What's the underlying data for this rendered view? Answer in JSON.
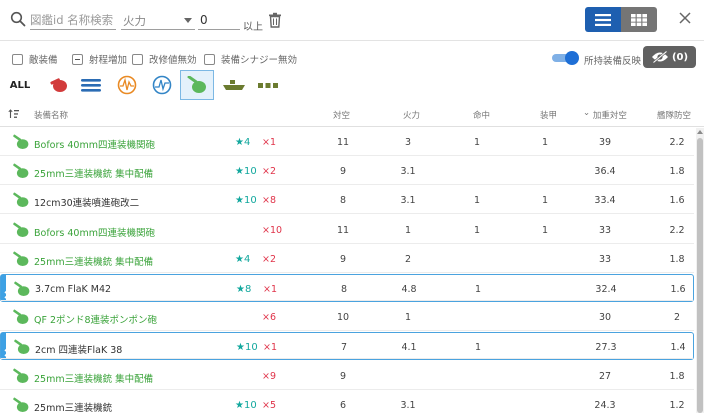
{
  "search": {
    "placeholder": "図鑑id 名称検索",
    "value": ""
  },
  "stat_filter": {
    "selected": "火力",
    "min_value": "0",
    "min_suffix": "以上"
  },
  "filters": [
    {
      "label": "敵装備",
      "checked": false,
      "state": "unchecked"
    },
    {
      "label": "射程増加",
      "checked": false,
      "state": "indeterminate"
    },
    {
      "label": "改修値無効",
      "checked": false,
      "state": "unchecked"
    },
    {
      "label": "装備シナジー無効",
      "checked": false,
      "state": "unchecked"
    }
  ],
  "owned_toggle": {
    "label": "所持装備反映",
    "on": true
  },
  "hidden_button": {
    "label": "(0)"
  },
  "type_tabs": [
    {
      "name": "all",
      "label": "ALL",
      "icon": "all",
      "active": false
    },
    {
      "name": "main-gun",
      "label": "",
      "icon": "main-gun-red-icon",
      "active": false
    },
    {
      "name": "torpedo",
      "label": "",
      "icon": "torpedo-icon",
      "active": false
    },
    {
      "name": "radar",
      "label": "",
      "icon": "radar-orange-icon",
      "active": false
    },
    {
      "name": "sonar",
      "label": "",
      "icon": "radar-blue-icon",
      "active": false
    },
    {
      "name": "aa-gun",
      "label": "",
      "icon": "aa-gun-green-icon",
      "active": true
    },
    {
      "name": "landing-craft",
      "label": "",
      "icon": "landing-craft-icon",
      "active": false
    },
    {
      "name": "misc",
      "label": "",
      "icon": "supply-icon",
      "active": false
    }
  ],
  "columns": {
    "name": "装備名称",
    "aa": "対空",
    "firepower": "火力",
    "accuracy": "命中",
    "armor": "装甲",
    "weighted_aa": "加重対空",
    "fleet_defense": "艦隊防空",
    "sort_indicator": "⌄"
  },
  "rows": [
    {
      "name": "Bofors 40mm四連装機関砲",
      "name_color": "green",
      "star": "★4",
      "count": "×1",
      "aa": "11",
      "firepower": "3",
      "accuracy": "1",
      "armor": "1",
      "weighted_aa": "39",
      "fleet_defense": "2.2",
      "selected": false
    },
    {
      "name": "25mm三連装機銃 集中配備",
      "name_color": "green",
      "star": "★10",
      "count": "×2",
      "aa": "9",
      "firepower": "3.1",
      "accuracy": "",
      "armor": "",
      "weighted_aa": "36.4",
      "fleet_defense": "1.8",
      "selected": false
    },
    {
      "name": "12cm30連装噴進砲改二",
      "name_color": "dark",
      "star": "★10",
      "count": "×8",
      "aa": "8",
      "firepower": "3.1",
      "accuracy": "1",
      "armor": "1",
      "weighted_aa": "33.4",
      "fleet_defense": "1.6",
      "selected": false
    },
    {
      "name": "Bofors 40mm四連装機関砲",
      "name_color": "green",
      "star": "",
      "count": "×10",
      "aa": "11",
      "firepower": "1",
      "accuracy": "1",
      "armor": "1",
      "weighted_aa": "33",
      "fleet_defense": "2.2",
      "selected": false
    },
    {
      "name": "25mm三連装機銃 集中配備",
      "name_color": "green",
      "star": "★4",
      "count": "×2",
      "aa": "9",
      "firepower": "2",
      "accuracy": "",
      "armor": "",
      "weighted_aa": "33",
      "fleet_defense": "1.8",
      "selected": false
    },
    {
      "name": "3.7cm FlaK M42",
      "name_color": "dark",
      "star": "★8",
      "count": "×1",
      "aa": "8",
      "firepower": "4.8",
      "accuracy": "1",
      "armor": "",
      "weighted_aa": "32.4",
      "fleet_defense": "1.6",
      "selected": true
    },
    {
      "name": "QF 2ポンド8連装ポンポン砲",
      "name_color": "green",
      "star": "",
      "count": "×6",
      "aa": "10",
      "firepower": "1",
      "accuracy": "",
      "armor": "",
      "weighted_aa": "30",
      "fleet_defense": "2",
      "selected": false
    },
    {
      "name": "2cm 四連装FlaK 38",
      "name_color": "dark",
      "star": "★10",
      "count": "×1",
      "aa": "7",
      "firepower": "4.1",
      "accuracy": "1",
      "armor": "",
      "weighted_aa": "27.3",
      "fleet_defense": "1.4",
      "selected": true
    },
    {
      "name": "25mm三連装機銃 集中配備",
      "name_color": "green",
      "star": "",
      "count": "×9",
      "aa": "9",
      "firepower": "",
      "accuracy": "",
      "armor": "",
      "weighted_aa": "27",
      "fleet_defense": "1.8",
      "selected": false
    },
    {
      "name": "25mm三連装機銃",
      "name_color": "dark",
      "star": "★10",
      "count": "×5",
      "aa": "6",
      "firepower": "3.1",
      "accuracy": "",
      "armor": "",
      "weighted_aa": "24.3",
      "fleet_defense": "1.2",
      "selected": false
    }
  ],
  "colors": {
    "accent_blue": "#1e5fb0",
    "green_name": "#3aa33a",
    "star_teal": "#13a89e",
    "count_red": "#e0344a",
    "selected_border": "#4aa3df"
  }
}
